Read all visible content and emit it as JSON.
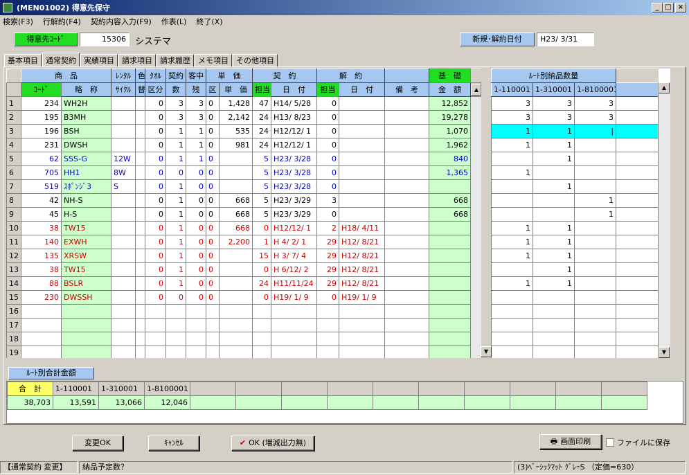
{
  "window": {
    "title": "(MEN01002) 得意先保守"
  },
  "menu": [
    "検索(F3)",
    "行解約(F4)",
    "契約内容入力(F9)",
    "作表(L)",
    "終了(X)"
  ],
  "customer": {
    "code_label": "得意先ｺｰﾄﾞ",
    "code": "15306",
    "name": "システマ",
    "date_label": "新規･解約日付",
    "date": "H23/ 3/31"
  },
  "tabs": [
    "基本項目",
    "通常契約",
    "実績項目",
    "請求項目",
    "請求履歴",
    "メモ項目",
    "その他項目"
  ],
  "grid": {
    "group_headers": [
      "商　品",
      "ﾚﾝﾀﾙ",
      "色",
      "ﾀｵﾙ",
      "契約",
      "客中",
      "単　価",
      "契　約",
      "解　約",
      "",
      "基　礎"
    ],
    "col_headers": [
      "ｺｰﾄﾞ",
      "略　称",
      "ｻｲｸﾙ",
      "替",
      "区分",
      "数",
      "残",
      "区",
      "単　価",
      "担当",
      "日　付",
      "担当",
      "日　付",
      "備　考",
      "金　額"
    ],
    "rows": [
      {
        "n": "1",
        "code": "234",
        "name": "WH2H",
        "cycle": "",
        "kae": "",
        "kubun": "0",
        "su": "3",
        "zan": "3",
        "ku": "0",
        "tanka": "1,428",
        "tanto": "47",
        "date": "H14/ 5/28",
        "ktanto": "0",
        "kdate": "",
        "biko": "",
        "kingaku": "12,852",
        "color": ""
      },
      {
        "n": "2",
        "code": "195",
        "name": "B3MH",
        "cycle": "",
        "kae": "",
        "kubun": "0",
        "su": "3",
        "zan": "3",
        "ku": "0",
        "tanka": "2,142",
        "tanto": "24",
        "date": "H13/ 8/23",
        "ktanto": "0",
        "kdate": "",
        "biko": "",
        "kingaku": "19,278",
        "color": ""
      },
      {
        "n": "3",
        "code": "196",
        "name": "BSH",
        "cycle": "",
        "kae": "",
        "kubun": "0",
        "su": "1",
        "zan": "1",
        "ku": "0",
        "tanka": "535",
        "tanto": "24",
        "date": "H12/12/ 1",
        "ktanto": "0",
        "kdate": "",
        "biko": "",
        "kingaku": "1,070",
        "color": ""
      },
      {
        "n": "4",
        "code": "231",
        "name": "DWSH",
        "cycle": "",
        "kae": "",
        "kubun": "0",
        "su": "1",
        "zan": "1",
        "ku": "0",
        "tanka": "981",
        "tanto": "24",
        "date": "H12/12/ 1",
        "ktanto": "0",
        "kdate": "",
        "biko": "",
        "kingaku": "1,962",
        "color": ""
      },
      {
        "n": "5",
        "code": "62",
        "name": "SSS-G",
        "cycle": "12W",
        "kae": "",
        "kubun": "0",
        "su": "1",
        "zan": "1",
        "ku": "0",
        "tanka": "",
        "tanto": "5",
        "date": "H23/ 3/28",
        "ktanto": "0",
        "kdate": "",
        "biko": "",
        "kingaku": "840",
        "color": "blue"
      },
      {
        "n": "6",
        "code": "705",
        "name": "HH1",
        "cycle": "8W",
        "kae": "",
        "kubun": "0",
        "su": "0",
        "zan": "0",
        "ku": "0",
        "tanka": "",
        "tanto": "5",
        "date": "H23/ 3/28",
        "ktanto": "0",
        "kdate": "",
        "biko": "",
        "kingaku": "1,365",
        "color": "blue"
      },
      {
        "n": "7",
        "code": "519",
        "name": "ｽﾎﾟﾝｼﾞ3",
        "cycle": "S",
        "kae": "",
        "kubun": "0",
        "su": "1",
        "zan": "0",
        "ku": "0",
        "tanka": "",
        "tanto": "5",
        "date": "H23/ 3/28",
        "ktanto": "0",
        "kdate": "",
        "biko": "",
        "kingaku": "",
        "color": "blue"
      },
      {
        "n": "8",
        "code": "42",
        "name": "NH-S",
        "cycle": "",
        "kae": "",
        "kubun": "0",
        "su": "1",
        "zan": "0",
        "ku": "0",
        "tanka": "668",
        "tanto": "5",
        "date": "H23/ 3/29",
        "ktanto": "3",
        "kdate": "",
        "biko": "",
        "kingaku": "668",
        "color": ""
      },
      {
        "n": "9",
        "code": "45",
        "name": "H-S",
        "cycle": "",
        "kae": "",
        "kubun": "0",
        "su": "1",
        "zan": "0",
        "ku": "0",
        "tanka": "668",
        "tanto": "5",
        "date": "H23/ 3/29",
        "ktanto": "0",
        "kdate": "",
        "biko": "",
        "kingaku": "668",
        "color": ""
      },
      {
        "n": "10",
        "code": "38",
        "name": "TW15",
        "cycle": "",
        "kae": "",
        "kubun": "0",
        "su": "1",
        "zan": "0",
        "ku": "0",
        "tanka": "668",
        "tanto": "0",
        "date": "H12/12/ 1",
        "ktanto": "2",
        "kdate": "H18/ 4/11",
        "biko": "",
        "kingaku": "",
        "color": "red"
      },
      {
        "n": "11",
        "code": "140",
        "name": "EXWH",
        "cycle": "",
        "kae": "",
        "kubun": "0",
        "su": "1",
        "zan": "0",
        "ku": "0",
        "tanka": "2,200",
        "tanto": "1",
        "date": "H 4/ 2/ 1",
        "ktanto": "29",
        "kdate": "H12/ 8/21",
        "biko": "",
        "kingaku": "",
        "color": "red"
      },
      {
        "n": "12",
        "code": "135",
        "name": "XRSW",
        "cycle": "",
        "kae": "",
        "kubun": "0",
        "su": "1",
        "zan": "0",
        "ku": "0",
        "tanka": "",
        "tanto": "15",
        "date": "H 3/ 7/ 4",
        "ktanto": "29",
        "kdate": "H12/ 8/21",
        "biko": "",
        "kingaku": "",
        "color": "red"
      },
      {
        "n": "13",
        "code": "38",
        "name": "TW15",
        "cycle": "",
        "kae": "",
        "kubun": "0",
        "su": "1",
        "zan": "0",
        "ku": "0",
        "tanka": "",
        "tanto": "0",
        "date": "H 6/12/ 2",
        "ktanto": "29",
        "kdate": "H12/ 8/21",
        "biko": "",
        "kingaku": "",
        "color": "red"
      },
      {
        "n": "14",
        "code": "88",
        "name": "BSLR",
        "cycle": "",
        "kae": "",
        "kubun": "0",
        "su": "1",
        "zan": "0",
        "ku": "0",
        "tanka": "",
        "tanto": "24",
        "date": "H11/11/24",
        "ktanto": "29",
        "kdate": "H12/ 8/21",
        "biko": "",
        "kingaku": "",
        "color": "red"
      },
      {
        "n": "15",
        "code": "230",
        "name": "DWSSH",
        "cycle": "",
        "kae": "",
        "kubun": "0",
        "su": "0",
        "zan": "0",
        "ku": "0",
        "tanka": "",
        "tanto": "0",
        "date": "H19/ 1/ 9",
        "ktanto": "0",
        "kdate": "H19/ 1/ 9",
        "biko": "",
        "kingaku": "",
        "color": "red"
      },
      {
        "n": "16"
      },
      {
        "n": "17"
      },
      {
        "n": "18"
      },
      {
        "n": "19"
      }
    ]
  },
  "route_grid": {
    "title": "ﾙｰﾄ別納品数量",
    "headers": [
      "1-110001",
      "1-310001",
      "1-8100001",
      ""
    ],
    "rows": [
      [
        "3",
        "3",
        "3",
        ""
      ],
      [
        "3",
        "3",
        "3",
        ""
      ],
      [
        "1",
        "1",
        "|",
        ""
      ],
      [
        "1",
        "1",
        "",
        ""
      ],
      [
        "",
        "1",
        "",
        ""
      ],
      [
        "1",
        "",
        "",
        ""
      ],
      [
        "",
        "1",
        "",
        ""
      ],
      [
        "",
        "",
        "1",
        ""
      ],
      [
        "",
        "",
        "1",
        ""
      ],
      [
        "1",
        "1",
        "",
        ""
      ],
      [
        "1",
        "1",
        "",
        ""
      ],
      [
        "1",
        "1",
        "",
        ""
      ],
      [
        "",
        "1",
        "",
        ""
      ],
      [
        "1",
        "1",
        "",
        ""
      ],
      [
        "",
        "",
        "",
        ""
      ],
      [
        "",
        "",
        "",
        ""
      ],
      [
        "",
        "",
        "",
        ""
      ],
      [
        "",
        "",
        "",
        ""
      ],
      [
        "",
        "",
        "",
        ""
      ]
    ]
  },
  "totals": {
    "title": "ﾙｰﾄ別合計金額",
    "headers": [
      "合　計",
      "1-110001",
      "1-310001",
      "1-8100001",
      "",
      "",
      "",
      "",
      "",
      "",
      "",
      "",
      "",
      "",
      ""
    ],
    "values": [
      "38,703",
      "13,591",
      "13,066",
      "12,046",
      "",
      "",
      "",
      "",
      "",
      "",
      "",
      "",
      "",
      "",
      ""
    ]
  },
  "buttons": {
    "change_ok": "変更OK",
    "cancel": "ｷｬﾝｾﾙ",
    "ok_no_print": "OK (増減出力無)",
    "print": "画面印刷",
    "save_file": "ファイルに保存"
  },
  "status": {
    "mode": "【通常契約 変更】",
    "prompt": "納品予定数？",
    "item": "(3)ﾍﾞｰｼｯｸﾏｯﾄ ｸﾞﾚｰS （定価=630）"
  }
}
